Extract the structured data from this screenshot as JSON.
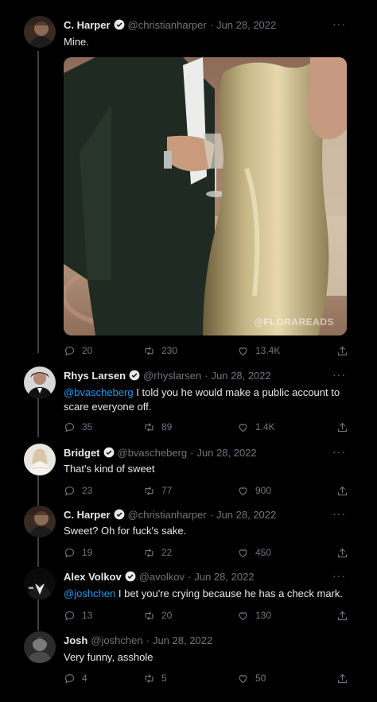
{
  "tweets": [
    {
      "name": "C. Harper",
      "handle": "@christianharper",
      "date": "Jun 28, 2022",
      "text": "Mine.",
      "replies": "20",
      "retweets": "230",
      "likes": "13.4K",
      "watermark": "@FLORAREADS"
    },
    {
      "name": "Rhys Larsen",
      "handle": "@rhyslarsen",
      "date": "Jun 28, 2022",
      "mention": "@bvascheberg",
      "text": " I told you he would make a public account to scare everyone off.",
      "replies": "35",
      "retweets": "89",
      "likes": "1.4K"
    },
    {
      "name": "Bridget",
      "handle": "@bvascheberg",
      "date": "Jun 28, 2022",
      "text": "That's kind of sweet",
      "replies": "23",
      "retweets": "77",
      "likes": "900"
    },
    {
      "name": "C. Harper",
      "handle": "@christianharper",
      "date": "Jun 28, 2022",
      "text": "Sweet? Oh for fuck's sake.",
      "replies": "19",
      "retweets": "22",
      "likes": "450"
    },
    {
      "name": "Alex Volkov",
      "handle": "@avolkov",
      "date": "Jun 28, 2022",
      "mention": "@joshchen",
      "text": " I bet you're crying because he has a check mark.",
      "replies": "13",
      "retweets": "20",
      "likes": "130"
    },
    {
      "name": "Josh",
      "handle": "@joshchen",
      "date": "Jun 28, 2022",
      "text": "Very funny, asshole",
      "replies": "4",
      "retweets": "5",
      "likes": "50"
    }
  ],
  "colors": {
    "background": "#000000",
    "text": "#e7e9ea",
    "muted": "#71767b",
    "accent": "#1d9bf0",
    "thread_line": "#3e4144"
  },
  "icons": [
    "reply-icon",
    "retweet-icon",
    "like-icon",
    "share-icon",
    "verified-icon",
    "more-icon"
  ]
}
